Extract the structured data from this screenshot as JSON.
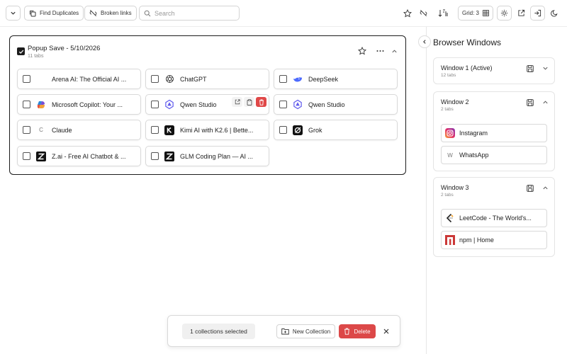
{
  "toolbar": {
    "find_duplicates_label": "Find Duplicates",
    "broken_links_label": "Broken links",
    "search_placeholder": "Search",
    "grid_label": "Grid: 3"
  },
  "collection": {
    "title": "Popup Save - 5/10/2026",
    "tab_count": "11 tabs",
    "tabs": [
      {
        "label": "Arena AI: The Official AI ...",
        "icon": "arena-icon"
      },
      {
        "label": "ChatGPT",
        "icon": "chatgpt-icon"
      },
      {
        "label": "DeepSeek",
        "icon": "deepseek-icon"
      },
      {
        "label": "Microsoft Copilot: Your ...",
        "icon": "copilot-icon"
      },
      {
        "label": "Qwen Studio",
        "icon": "qwen-icon"
      },
      {
        "label": "Qwen Studio",
        "icon": "qwen-icon"
      },
      {
        "label": "Claude",
        "icon": "claude-icon"
      },
      {
        "label": "Kimi AI with K2.6 | Bette...",
        "icon": "kimi-icon"
      },
      {
        "label": "Grok",
        "icon": "grok-icon"
      },
      {
        "label": "Z.ai - Free AI Chatbot & ...",
        "icon": "zai-icon"
      },
      {
        "label": "GLM Coding Plan — AI ...",
        "icon": "zai-icon"
      }
    ],
    "claude_favicon_letter": "C"
  },
  "panel": {
    "title": "Browser Windows",
    "windows": [
      {
        "name": "Window 1 (Active)",
        "count": "12 tabs"
      },
      {
        "name": "Window 2",
        "count": "2 tabs",
        "tabs": [
          {
            "label": "Instagram",
            "icon": "instagram-icon"
          },
          {
            "label": "WhatsApp",
            "icon": "whatsapp-icon",
            "letter": "W"
          }
        ]
      },
      {
        "name": "Window 3",
        "count": "2 tabs",
        "tabs": [
          {
            "label": "LeetCode - The World's...",
            "icon": "leetcode-icon"
          },
          {
            "label": "npm | Home",
            "icon": "npm-icon"
          }
        ]
      }
    ]
  },
  "bottom_bar": {
    "selection_text": "1 collections selected",
    "new_collection_label": "New Collection",
    "delete_label": "Delete"
  },
  "colors": {
    "accent_dark": "#1c1c1c",
    "danger": "#dc4848",
    "border": "#d9d9d9"
  }
}
